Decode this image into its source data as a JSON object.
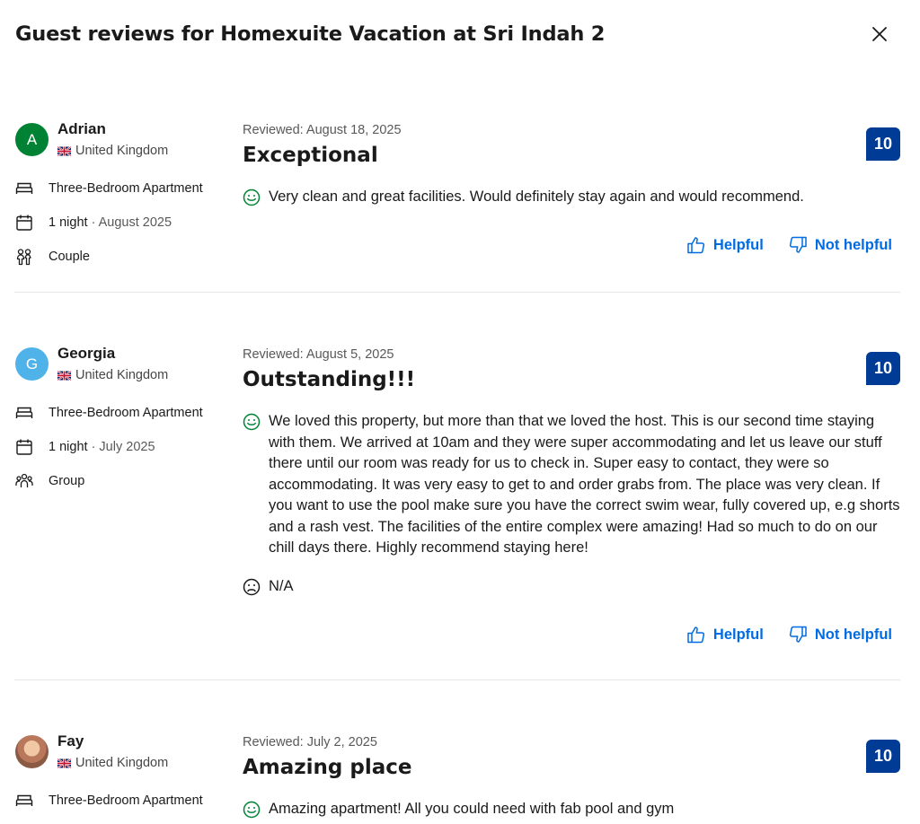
{
  "header": {
    "title": "Guest reviews for Homexuite Vacation at Sri Indah 2",
    "close_icon": "close-icon"
  },
  "actions": {
    "helpful_label": "Helpful",
    "not_helpful_label": "Not helpful"
  },
  "colors": {
    "score_bg": "#003b95",
    "link": "#006ce4",
    "avatar_green": "#008234",
    "avatar_blue": "#4fb2e8",
    "positive_icon": "#008234"
  },
  "reviews": [
    {
      "initial": "A",
      "name": "Adrian",
      "country": "United Kingdom",
      "room": "Three-Bedroom Apartment",
      "nights": "1 night",
      "stay_date": "· August 2025",
      "traveler_type": "Couple",
      "reviewed": "Reviewed: August 18, 2025",
      "title": "Exceptional",
      "score": "10",
      "positive": "Very clean and great facilities. Would definitely stay again and would recommend."
    },
    {
      "initial": "G",
      "name": "Georgia",
      "country": "United Kingdom",
      "room": "Three-Bedroom Apartment",
      "nights": "1 night",
      "stay_date": "· July 2025",
      "traveler_type": "Group",
      "reviewed": "Reviewed: August 5, 2025",
      "title": "Outstanding!!!",
      "score": "10",
      "positive": "We loved this property, but more than that we loved the host. This is our second time staying with them. We arrived at 10am and they were super accommodating and let us leave our stuff there until our room was ready for us to check in. Super easy to contact, they were so accommodating. It was very easy to get to and order grabs from. The place was very clean. If you want to use the pool make sure you have the correct swim wear, fully covered up, e.g shorts and a rash vest. The facilities of the entire complex were amazing! Had so much to do on our chill days there. Highly recommend staying here!",
      "negative": "N/A"
    },
    {
      "name": "Fay",
      "country": "United Kingdom",
      "room": "Three-Bedroom Apartment",
      "reviewed": "Reviewed: July 2, 2025",
      "title": "Amazing place",
      "score": "10",
      "positive": "Amazing apartment! All you could need with fab pool and gym"
    }
  ]
}
